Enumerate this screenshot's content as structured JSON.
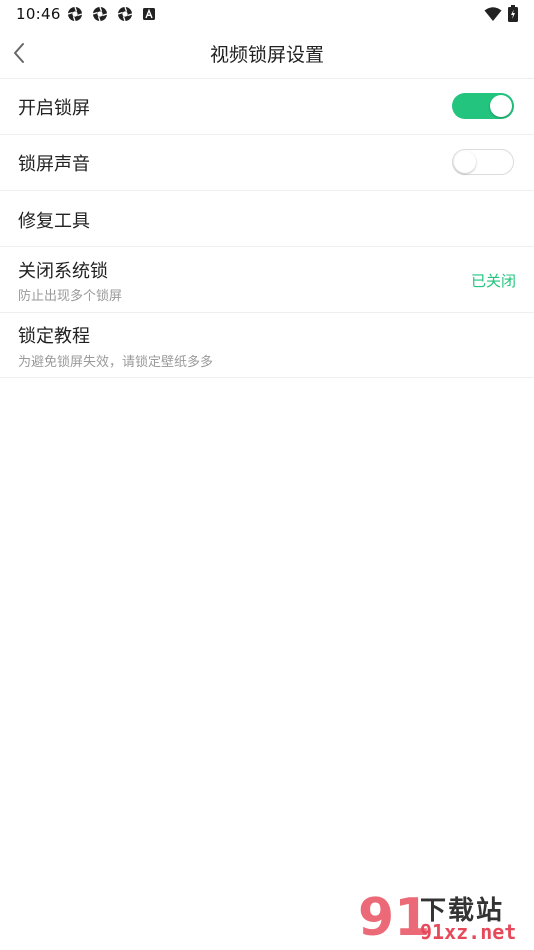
{
  "status_bar": {
    "time": "10:46",
    "icons": [
      "aperture-icon",
      "aperture-icon",
      "aperture-icon",
      "a-badge-icon"
    ],
    "right_icons": [
      "wifi-icon",
      "battery-icon"
    ]
  },
  "header": {
    "title": "视频锁屏设置",
    "back_icon": "chevron-left-icon"
  },
  "settings": {
    "items": [
      {
        "label": "开启锁屏",
        "toggle": "on"
      },
      {
        "label": "锁屏声音",
        "toggle": "off"
      },
      {
        "label": "修复工具"
      },
      {
        "label": "关闭系统锁",
        "sub": "防止出现多个锁屏",
        "status": "已关闭"
      },
      {
        "label": "锁定教程",
        "sub": "为避免锁屏失效，请锁定壁纸多多"
      }
    ]
  },
  "watermark": {
    "logo": "91",
    "text": "下载站",
    "url": "91xz.net"
  },
  "colors": {
    "accent": "#22c47e",
    "watermark_red": "#e64a5a"
  }
}
